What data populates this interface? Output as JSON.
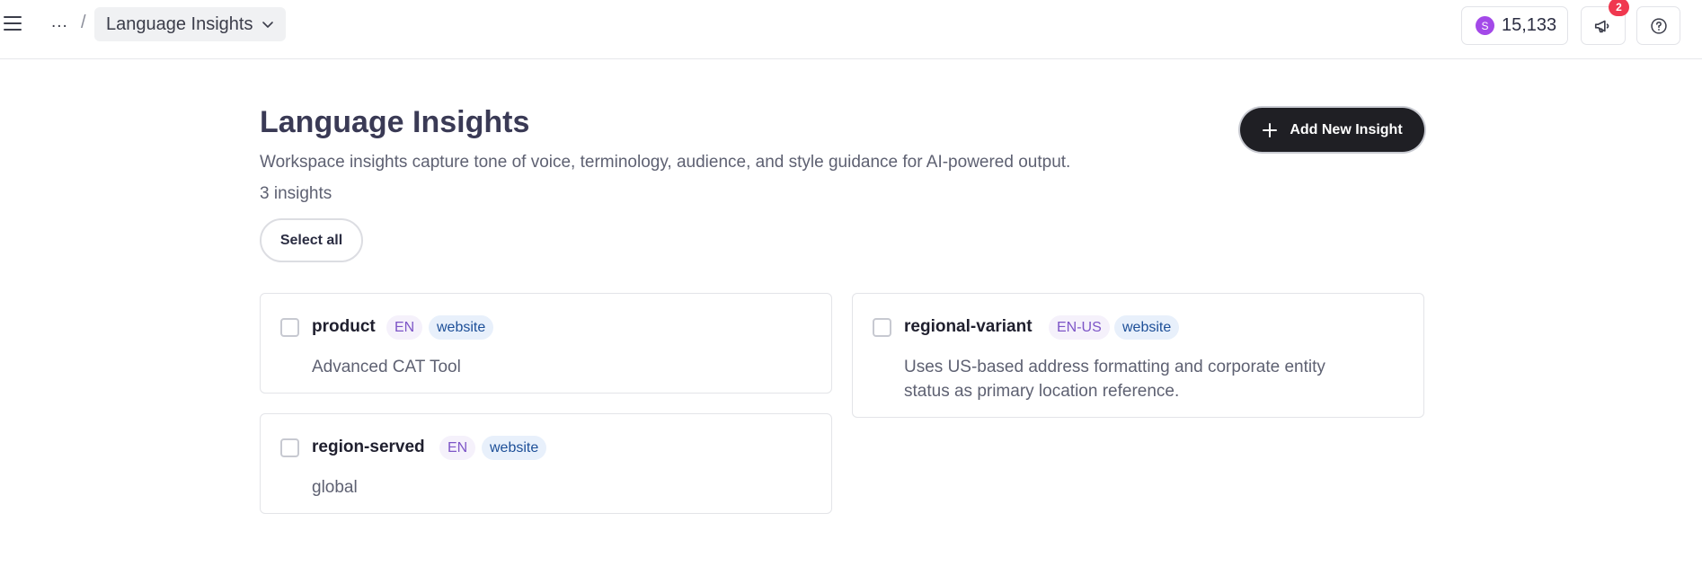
{
  "header": {
    "breadcrumb_ellipsis": "...",
    "breadcrumb_separator": "/",
    "breadcrumb_current": "Language Insights",
    "credits_avatar_letter": "S",
    "credits_amount": "15,133",
    "notifications_count": "2"
  },
  "main": {
    "title": "Language Insights",
    "description": "Workspace insights capture tone of voice, terminology, audience, and style guidance for AI-powered output.",
    "count": "3 insights",
    "select_all_label": "Select all",
    "add_button_label": "Add New Insight"
  },
  "insights": [
    {
      "name": "product",
      "lang": "EN",
      "tag": "website",
      "text": "Advanced CAT Tool"
    },
    {
      "name": "regional-variant",
      "lang": "EN-US",
      "tag": "website",
      "text": "Uses US-based address formatting and corporate entity status as primary location reference."
    },
    {
      "name": "region-served",
      "lang": "EN",
      "tag": "website",
      "text": "global"
    }
  ],
  "colors": {
    "primary_button": "#1f1f24",
    "badge": "#f0384f",
    "coin": "#a349e8",
    "lang_tag_text": "#7d55c7",
    "kind_tag_text": "#1d4f98"
  },
  "icons": {
    "menu": "hamburger-icon",
    "chevron": "chevron-down-icon",
    "announcements": "megaphone-icon",
    "help": "question-circle-icon",
    "add": "plus-icon"
  }
}
